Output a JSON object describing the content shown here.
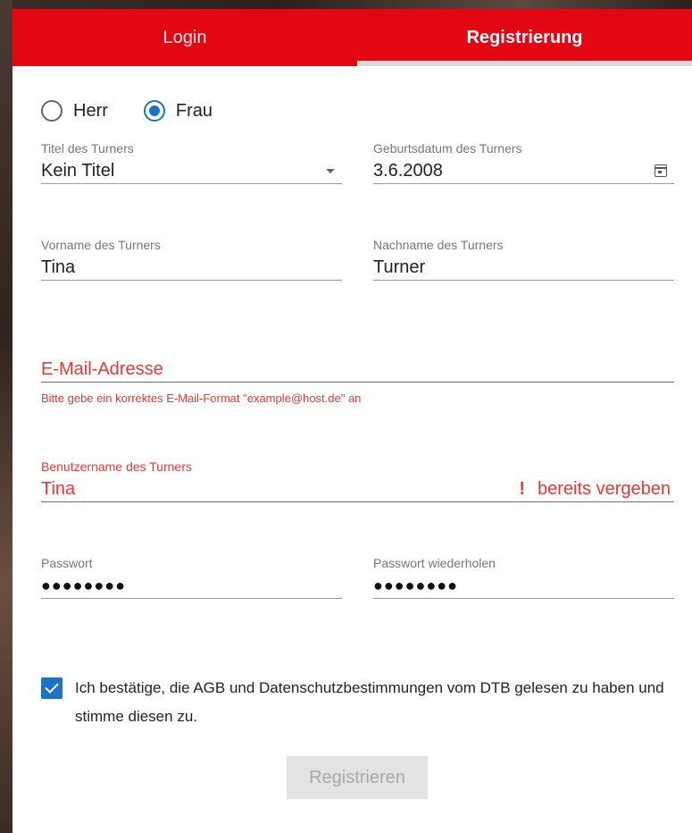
{
  "tabs": {
    "login": "Login",
    "register": "Registrierung"
  },
  "gender": {
    "options": [
      "Herr",
      "Frau"
    ],
    "selected": "Frau"
  },
  "fields": {
    "title": {
      "label": "Titel des Turners",
      "value": "Kein Titel"
    },
    "birthdate": {
      "label": "Geburtsdatum des Turners",
      "value": "3.6.2008"
    },
    "firstname": {
      "label": "Vorname des Turners",
      "value": "Tina"
    },
    "lastname": {
      "label": "Nachname des Turners",
      "value": "Turner"
    },
    "email": {
      "placeholder": "E-Mail-Adresse",
      "error": "Bitte gebe ein korrektes E-Mail-Format \"example@host.de\" an"
    },
    "username": {
      "label": "Benutzername des Turners",
      "value": "Tina",
      "error_mark": "!",
      "error": "bereits vergeben"
    },
    "password": {
      "label": "Passwort",
      "value": "●●●●●●●●"
    },
    "password_repeat": {
      "label": "Passwort wiederholen",
      "value": "●●●●●●●●"
    }
  },
  "consent": {
    "checked": true,
    "text": "Ich bestätige, die AGB und Datenschutzbestimmungen vom DTB gelesen zu haben und stimme diesen zu."
  },
  "submit_label": "Registrieren",
  "colors": {
    "brand": "#e30613",
    "accent": "#1a73c8",
    "error": "#e53935"
  }
}
